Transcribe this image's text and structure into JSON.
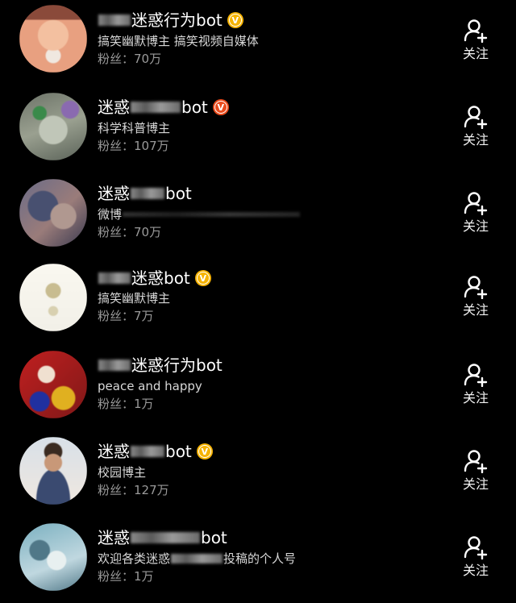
{
  "follow_label": "关注",
  "accounts": [
    {
      "name_pre": "",
      "name_post": "迷惑行为bot",
      "verified": true,
      "badge_letter": "V",
      "badge_color": "#f6b300",
      "description": "搞笑幽默博主 搞笑视频自媒体",
      "fans": "粉丝：70万",
      "avatar_colors": [
        "#e8a080",
        "#c0604a",
        "#f3c0a0",
        "#9a4a3a"
      ]
    },
    {
      "name_pre": "迷惑",
      "name_post": "bot",
      "verified": true,
      "badge_letter": "V",
      "badge_color": "#ea4b1c",
      "description": "科学科普博主",
      "fans": "粉丝：107万",
      "avatar_colors": [
        "#9aa090",
        "#6c7368",
        "#c0c6b8",
        "#8a6ab0"
      ]
    },
    {
      "name_pre": "迷惑",
      "name_post": "bot",
      "verified": false,
      "description": "微博",
      "fans": "粉丝：70万",
      "avatar_colors": [
        "#6a6c88",
        "#9a7c7a",
        "#485070",
        "#b09890"
      ]
    },
    {
      "name_pre": "",
      "name_post": "迷惑bot",
      "verified": true,
      "badge_letter": "V",
      "badge_color": "#f6b300",
      "description": "搞笑幽默博主",
      "fans": "粉丝：7万",
      "avatar_colors": [
        "#f2f0e8",
        "#d8d0b0",
        "#faf8f0",
        "#c8bc90"
      ]
    },
    {
      "name_pre": "",
      "name_post": "迷惑行为bot",
      "verified": false,
      "description": "peace and happy",
      "fans": "粉丝：1万",
      "avatar_colors": [
        "#c02020",
        "#e0b020",
        "#2030a0",
        "#f0e0d0"
      ]
    },
    {
      "name_pre": "迷惑",
      "name_post": "bot",
      "verified": true,
      "badge_letter": "V",
      "badge_color": "#f6b300",
      "description": "校园博主",
      "fans": "粉丝：127万",
      "avatar_colors": [
        "#d8e0e8",
        "#6a5040",
        "#f0e8e0",
        "#3a4a70"
      ]
    },
    {
      "name_pre": "迷惑",
      "name_post": "bot",
      "verified": false,
      "description_pre": "欢迎各类迷惑",
      "description_post": "投稿的个人号",
      "fans": "粉丝：1万",
      "avatar_colors": [
        "#7ab0c0",
        "#c0d8e0",
        "#507888",
        "#e8f0f0"
      ]
    }
  ]
}
